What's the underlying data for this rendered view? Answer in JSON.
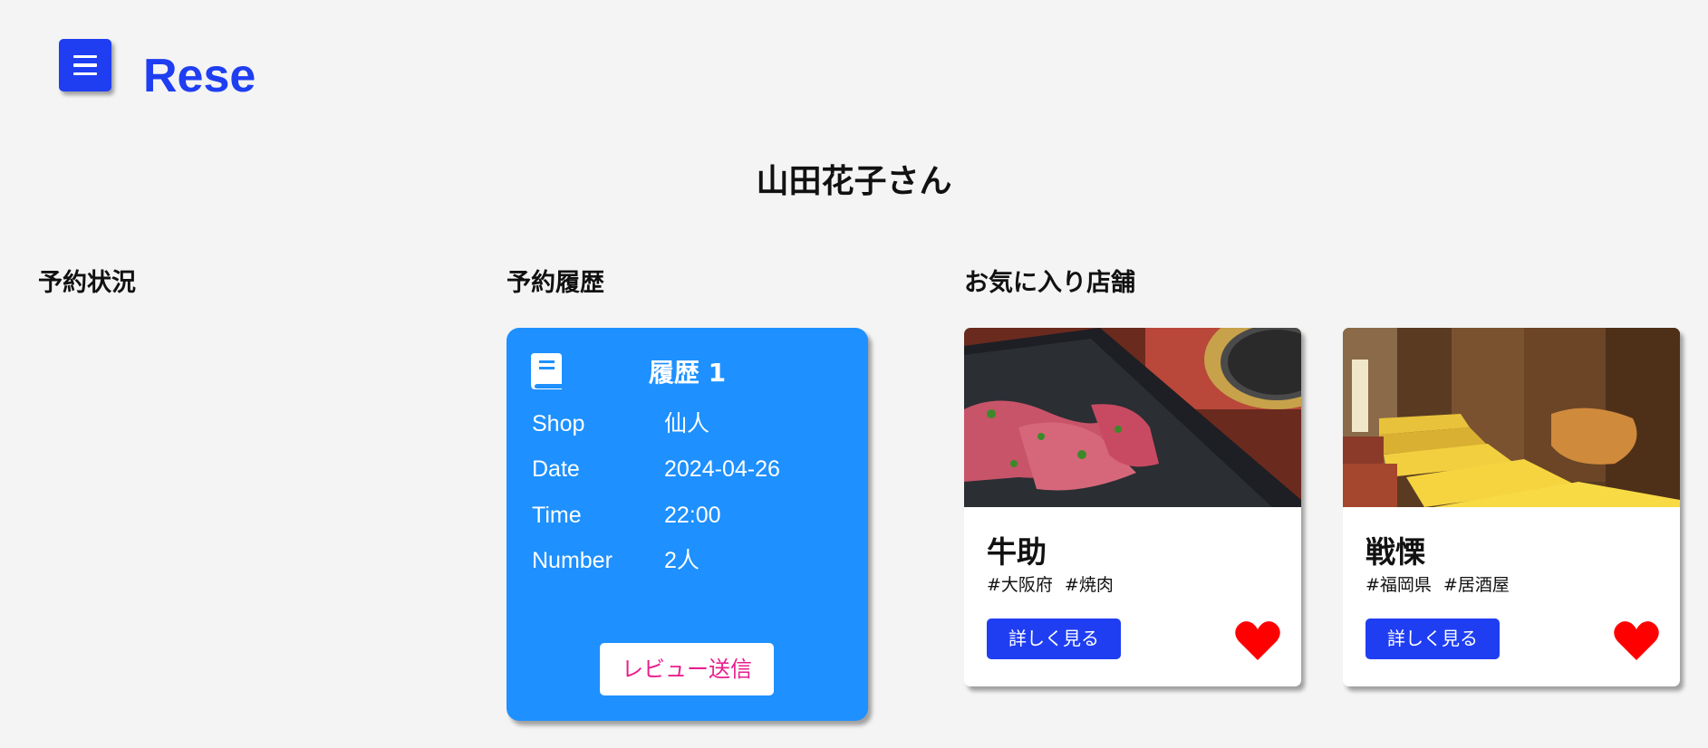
{
  "app": {
    "logo": "Rese",
    "menu_icon": "hamburger-menu-icon"
  },
  "user": {
    "greeting": "山田花子さん"
  },
  "sections": {
    "reservations_title": "予約状況",
    "history_title": "予約履歴",
    "favorites_title": "お気に入り店舗"
  },
  "history": [
    {
      "title": "履歴 1",
      "icon": "book-icon",
      "shop_label": "Shop",
      "shop_value": "仙人",
      "date_label": "Date",
      "date_value": "2024-04-26",
      "time_label": "Time",
      "time_value": "22:00",
      "number_label": "Number",
      "number_value": "2人",
      "review_button": "レビュー送信"
    }
  ],
  "favorites": [
    {
      "name": "牛助",
      "tag_area": "#大阪府",
      "tag_genre": "#焼肉",
      "button": "詳しく見る",
      "favorite": true
    },
    {
      "name": "戦慄",
      "tag_area": "#福岡県",
      "tag_genre": "#居酒屋",
      "button": "詳しく見る",
      "favorite": true
    }
  ],
  "colors": {
    "brand": "#1f3ef2",
    "history_card": "#1e90ff",
    "review_text": "#e91e8c",
    "heart": "#ff0000",
    "background": "#f4f4f4"
  }
}
